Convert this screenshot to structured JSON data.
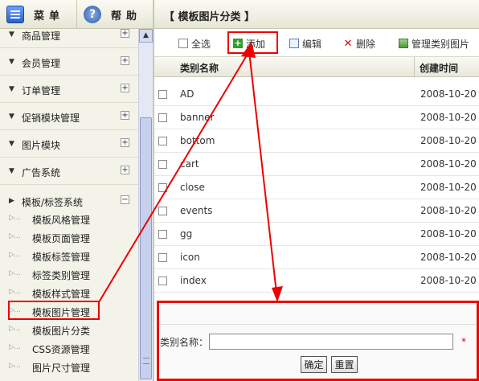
{
  "topbar": {
    "menu_label": "菜单",
    "help_label": "帮助",
    "page_title": "【 模板图片分类 】"
  },
  "sidebar": {
    "groups": [
      {
        "label": "商品管理",
        "toggle": "+"
      },
      {
        "label": "会员管理",
        "toggle": "+"
      },
      {
        "label": "订单管理",
        "toggle": "+"
      },
      {
        "label": "促销模块管理",
        "toggle": "+"
      },
      {
        "label": "图片模块",
        "toggle": "+"
      },
      {
        "label": "广告系统",
        "toggle": "+"
      },
      {
        "label": "模板/标签系统",
        "toggle": "−"
      }
    ],
    "items": [
      {
        "label": "模板风格管理"
      },
      {
        "label": "模板页面管理"
      },
      {
        "label": "模板标签管理"
      },
      {
        "label": "标签类别管理"
      },
      {
        "label": "模板样式管理"
      },
      {
        "label": "模板图片管理"
      },
      {
        "label": "模板图片分类"
      },
      {
        "label": "CSS资源管理"
      },
      {
        "label": "图片尺寸管理"
      }
    ]
  },
  "toolbar": {
    "select_all": "全选",
    "add": "添加",
    "edit": "编辑",
    "delete": "删除",
    "manage_images": "管理类别图片"
  },
  "table": {
    "columns": [
      "类别名称",
      "创建时间"
    ],
    "rows": [
      {
        "name": "AD",
        "created": "2008-10-20"
      },
      {
        "name": "banner",
        "created": "2008-10-20"
      },
      {
        "name": "bottom",
        "created": "2008-10-20"
      },
      {
        "name": "cart",
        "created": "2008-10-20"
      },
      {
        "name": "close",
        "created": "2008-10-20"
      },
      {
        "name": "events",
        "created": "2008-10-20"
      },
      {
        "name": "gg",
        "created": "2008-10-20"
      },
      {
        "name": "icon",
        "created": "2008-10-20"
      },
      {
        "name": "index",
        "created": "2008-10-20"
      }
    ]
  },
  "form": {
    "label": "类别名称：",
    "value": "",
    "required_mark": "*",
    "ok": "确定",
    "reset": "重置"
  },
  "colors": {
    "highlight": "#e00000",
    "sidebar_bg": "#f3f3ea",
    "header_bg": "#e8e8dc"
  },
  "icons": [
    "menu-icon",
    "help-icon",
    "add-icon",
    "edit-icon",
    "delete-icon",
    "manage-images-icon"
  ]
}
